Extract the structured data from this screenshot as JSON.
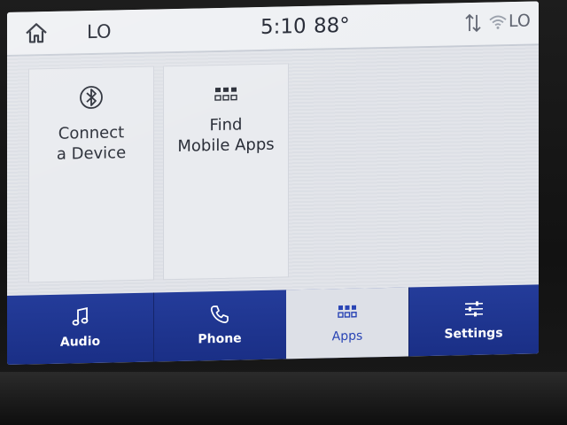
{
  "status_bar": {
    "home_icon": "home-icon",
    "left_climate": "LO",
    "time": "5:10",
    "temperature": "88°",
    "right_climate": "LO",
    "signal_icon": "signal-arrows-icon",
    "wifi_icon": "wifi-icon"
  },
  "tiles": [
    {
      "icon": "bluetooth-icon",
      "line1": "Connect",
      "line2": "a Device"
    },
    {
      "icon": "apps-grid-icon",
      "line1": "Find",
      "line2": "Mobile Apps"
    }
  ],
  "nav": [
    {
      "label": "Audio",
      "icon": "music-note-icon",
      "active": false
    },
    {
      "label": "Phone",
      "icon": "phone-icon",
      "active": false
    },
    {
      "label": "Apps",
      "icon": "apps-grid-icon",
      "active": true
    },
    {
      "label": "Settings",
      "icon": "sliders-icon",
      "active": false
    }
  ],
  "colors": {
    "nav_background": "#1f3590",
    "active_tab_background": "#dde0e7",
    "active_tab_text": "#2a45b5",
    "screen_background": "#e6e8ec"
  }
}
